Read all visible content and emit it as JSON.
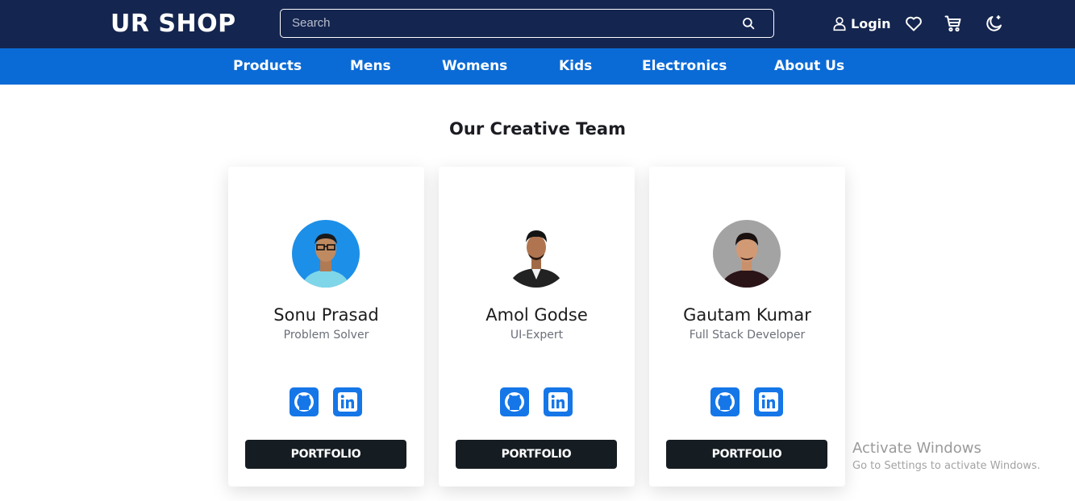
{
  "header": {
    "logo": "UR SHOP",
    "search": {
      "placeholder": "Search",
      "value": ""
    },
    "login_label": "Login",
    "icons": [
      "user-icon",
      "heart-icon",
      "cart-icon",
      "moon-icon",
      "search-icon"
    ]
  },
  "nav": {
    "items": [
      {
        "label": "Products"
      },
      {
        "label": "Mens"
      },
      {
        "label": "Womens"
      },
      {
        "label": "Kids"
      },
      {
        "label": "Electronics"
      },
      {
        "label": "About Us"
      }
    ]
  },
  "team": {
    "title": "Our Creative Team",
    "members": [
      {
        "name": "Sonu Prasad",
        "role": "Problem Solver",
        "button": "PORTFOLIO"
      },
      {
        "name": "Amol Godse",
        "role": "UI-Expert",
        "button": "PORTFOLIO"
      },
      {
        "name": "Gautam Kumar",
        "role": "Full Stack Developer",
        "button": "PORTFOLIO"
      }
    ],
    "social_icons": [
      "github-icon",
      "linkedin-icon"
    ]
  },
  "watermark": {
    "title": "Activate Windows",
    "subtitle": "Go to Settings to activate Windows."
  },
  "colors": {
    "header_bg": "#14254f",
    "nav_bg": "#0b6bd6",
    "social_bg": "#1576e8",
    "button_bg": "#161d22"
  }
}
